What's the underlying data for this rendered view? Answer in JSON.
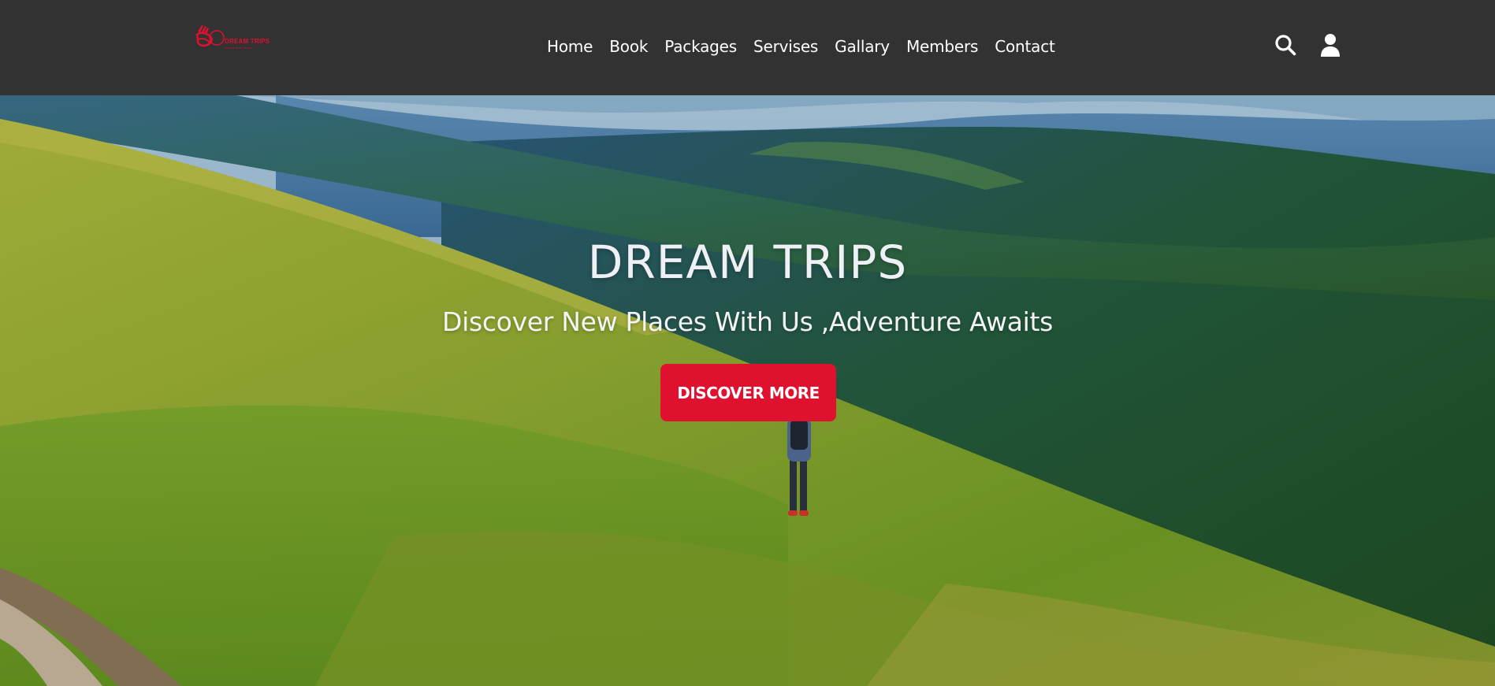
{
  "brand": {
    "name": "DREAM TRIPS",
    "tagline": "travel and tours",
    "logo_icon": "camel-caravan-logo",
    "color": "#e0102f"
  },
  "nav": {
    "items": [
      {
        "label": "Home"
      },
      {
        "label": "Book"
      },
      {
        "label": "Packages"
      },
      {
        "label": "Servises"
      },
      {
        "label": "Gallary"
      },
      {
        "label": "Members"
      },
      {
        "label": "Contact"
      }
    ],
    "icons": [
      "search-icon",
      "user-icon"
    ]
  },
  "hero": {
    "title": "DREAM TRIPS",
    "subtitle": "Discover New Places With Us ,Adventure Awaits",
    "button_label": "DISCOVER MORE",
    "background": "hiker-on-green-mountain-slope"
  },
  "colors": {
    "navbar": "#323232",
    "accent": "#e0102f",
    "text": "#ffffff"
  }
}
